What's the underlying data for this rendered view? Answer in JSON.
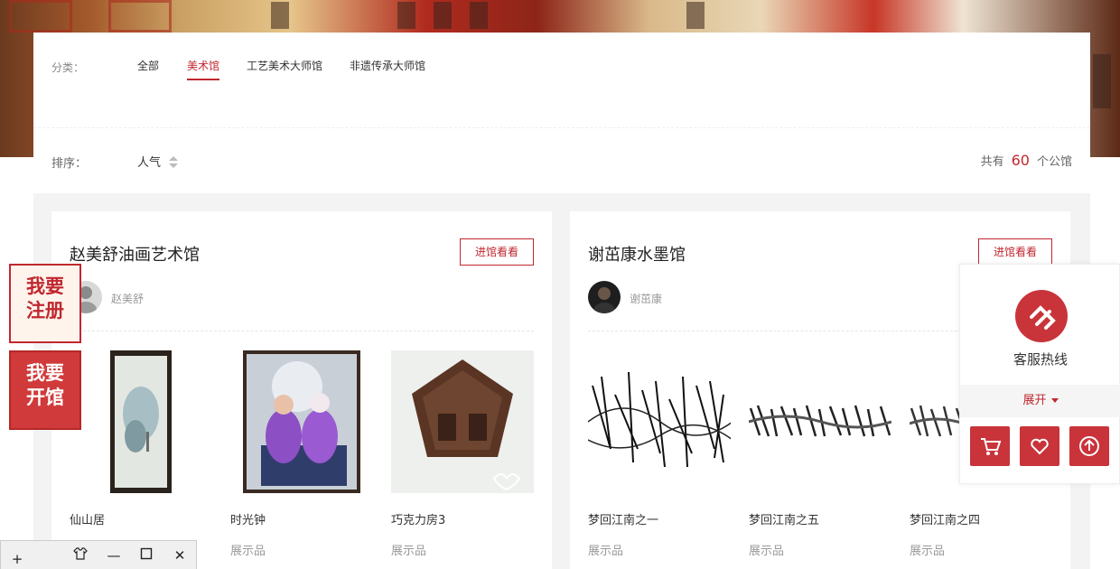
{
  "filter": {
    "label": "分类：",
    "categories": [
      {
        "label": "全部",
        "active": false
      },
      {
        "label": "美术馆",
        "active": true
      },
      {
        "label": "工艺美术大师馆",
        "active": false
      },
      {
        "label": "非遗传承大师馆",
        "active": false
      }
    ]
  },
  "sort": {
    "label": "排序：",
    "option": "人气",
    "total_prefix": "共有",
    "total_count": "60",
    "total_suffix": "个公馆"
  },
  "galleries": [
    {
      "title": "赵美舒油画艺术馆",
      "enter_label": "进馆看看",
      "owner": "赵美舒",
      "works": [
        {
          "name": "仙山居",
          "type": "展示品"
        },
        {
          "name": "时光钟",
          "type": "展示品"
        },
        {
          "name": "巧克力房3",
          "type": "展示品"
        }
      ]
    },
    {
      "title": "谢茁康水墨馆",
      "enter_label": "进馆看看",
      "owner": "谢茁康",
      "works": [
        {
          "name": "梦回江南之一",
          "type": "展示品"
        },
        {
          "name": "梦回江南之五",
          "type": "展示品"
        },
        {
          "name": "梦回江南之四",
          "type": "展示品"
        }
      ]
    }
  ],
  "side_badges": {
    "register": {
      "line1": "我要",
      "line2": "注册"
    },
    "open": {
      "line1": "我要",
      "line2": "开馆"
    }
  },
  "service_panel": {
    "hotline": "客服热线",
    "expand": "展开",
    "icons": [
      "cart-icon",
      "heart-icon",
      "back-to-top-icon"
    ]
  },
  "colors": {
    "accent": "#c0282f",
    "panel_red": "#c8343a"
  }
}
